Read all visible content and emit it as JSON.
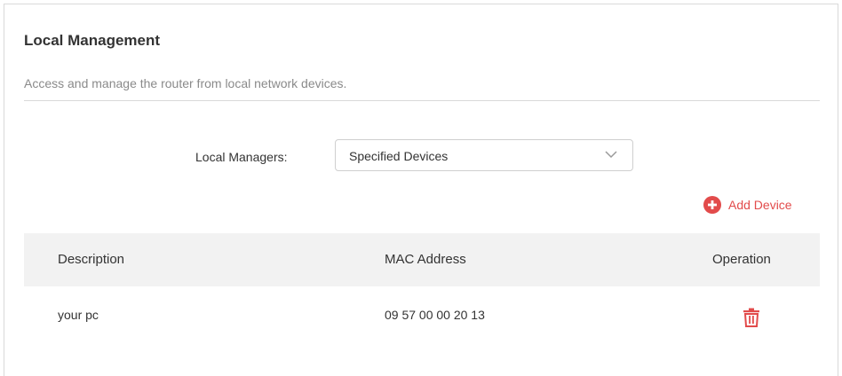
{
  "section": {
    "title": "Local Management",
    "description": "Access and manage the router from local network devices."
  },
  "local_managers": {
    "label": "Local Managers:",
    "selected": "Specified Devices",
    "icon": "chevron-down-icon"
  },
  "add_device": {
    "label": "Add Device",
    "icon": "plus-circle-icon",
    "color": "#e24b4b"
  },
  "table": {
    "headers": [
      "Description",
      "MAC Address",
      "Operation"
    ],
    "rows": [
      {
        "description": "your pc",
        "mac": "09 57 00 00 20 13",
        "operation_icon": "trash-icon"
      }
    ],
    "header_bg": "#f2f2f2"
  }
}
